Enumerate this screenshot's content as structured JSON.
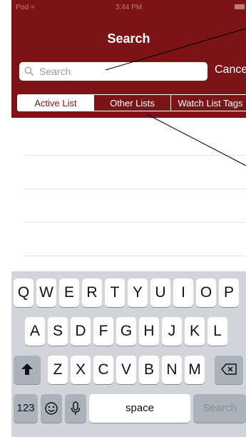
{
  "status_bar": {
    "carrier": "Pod",
    "wifi_icon": "wifi-icon",
    "time": "3:44 PM",
    "battery_icon": "battery-icon"
  },
  "nav": {
    "title": "Search"
  },
  "search": {
    "placeholder": "Search",
    "cancel_label": "Cancel"
  },
  "segments": [
    {
      "label": "Active List",
      "selected": true
    },
    {
      "label": "Other  Lists",
      "selected": false
    },
    {
      "label": "Watch List Tags",
      "selected": false
    }
  ],
  "keyboard": {
    "row1": [
      "Q",
      "W",
      "E",
      "R",
      "T",
      "Y",
      "U",
      "I",
      "O",
      "P"
    ],
    "row2": [
      "A",
      "S",
      "D",
      "F",
      "G",
      "H",
      "J",
      "K",
      "L"
    ],
    "row3": [
      "Z",
      "X",
      "C",
      "V",
      "B",
      "N",
      "M"
    ],
    "shift_icon": "shift-arrow-icon",
    "backspace_icon": "backspace-icon",
    "numbers_label": "123",
    "emoji_icon": "emoji-icon",
    "mic_icon": "microphone-icon",
    "space_label": "space",
    "return_label": "Search"
  },
  "colors": {
    "header_bg": "#7b1416",
    "keyboard_bg": "#d1d4d9"
  }
}
